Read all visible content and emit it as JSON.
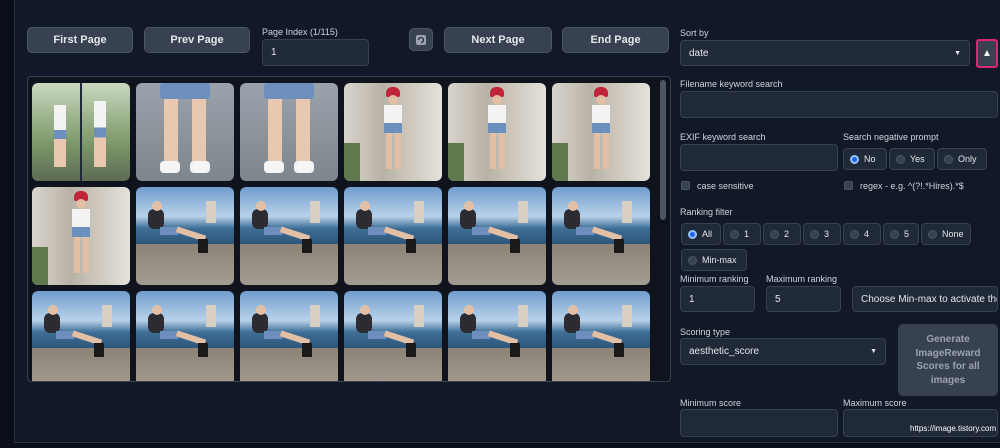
{
  "nav": {
    "first_page": "First Page",
    "prev_page": "Prev Page",
    "page_index_label": "Page Index (1/115)",
    "page_index_value": "1",
    "refresh_icon": "refresh-icon",
    "next_page": "Next Page",
    "end_page": "End Page"
  },
  "gallery": {
    "rows": [
      [
        "standing-side-by-side",
        "legs-closeup",
        "legs-closeup",
        "standing-street",
        "standing-street",
        "standing-street"
      ],
      [
        "standing-street",
        "sitting-seaside",
        "sitting-seaside",
        "sitting-seaside",
        "sitting-seaside",
        "sitting-seaside"
      ],
      [
        "sitting-seaside",
        "sitting-seaside",
        "sitting-seaside",
        "sitting-seaside",
        "sitting-seaside",
        "sitting-seaside"
      ]
    ]
  },
  "sort": {
    "label": "Sort by",
    "value": "date",
    "direction_icon": "sort-ascending-icon"
  },
  "filename_search": {
    "label": "Filename keyword search",
    "value": ""
  },
  "exif_search": {
    "label": "EXIF keyword search",
    "value": "",
    "case_sensitive_label": "case sensitive"
  },
  "negative_prompt": {
    "label": "Search negative prompt",
    "options": [
      "No",
      "Yes",
      "Only"
    ],
    "selected": "No",
    "regex_label": "regex - e.g. ^(?!.*Hires).*$"
  },
  "ranking_filter": {
    "label": "Ranking filter",
    "options": [
      "All",
      "1",
      "2",
      "3",
      "4",
      "5",
      "None",
      "Min-max"
    ],
    "selected": "All",
    "min_label": "Minimum ranking",
    "min_value": "1",
    "max_label": "Maximum ranking",
    "max_value": "5",
    "note": "Choose Min-max to activate these controls"
  },
  "scoring": {
    "label": "Scoring type",
    "value": "aesthetic_score",
    "generate_button": "Generate ImageReward Scores for all images",
    "min_label": "Minimum score",
    "max_label": "Maximum score"
  },
  "watermark": "https://image.tistory.com",
  "colors": {
    "accent": "#2563eb",
    "sort_button_border": "#db2777",
    "background": "#111827"
  }
}
